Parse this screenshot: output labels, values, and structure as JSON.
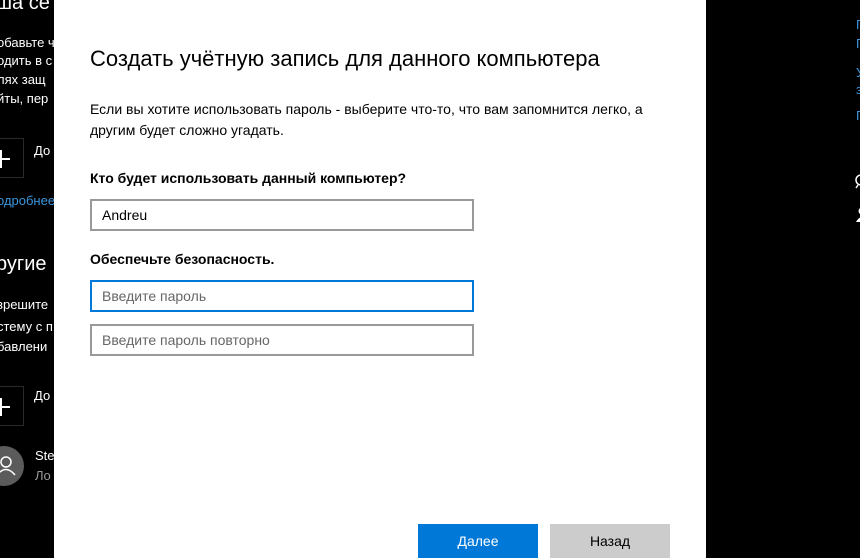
{
  "background_left": {
    "heading_top": "ша се",
    "texts": [
      "обавьте ч",
      "одить в с",
      "лях защ",
      "йты, пер"
    ],
    "add_item_1": "До",
    "link": "одробнее",
    "heading_other": "ругие",
    "texts2": [
      "зрешите",
      "стему с п",
      "бавлени"
    ],
    "add_item_2": "До",
    "user_name": "Ste",
    "user_sub": "Ло"
  },
  "background_right": {
    "links": [
      "Г",
      "П",
      "У",
      "з",
      "П"
    ]
  },
  "dialog": {
    "title": "Создать учётную запись для данного компьютера",
    "description": "Если вы хотите использовать пароль - выберите что-то, что вам запомнится легко, а другим будет сложно угадать.",
    "who_label": "Кто будет использовать данный компьютер?",
    "username_value": "Andreu",
    "security_label": "Обеспечьте безопасность.",
    "password_placeholder": "Введите пароль",
    "password_repeat_placeholder": "Введите пароль повторно",
    "next_button": "Далее",
    "back_button": "Назад"
  },
  "colors": {
    "accent": "#0078d7",
    "link": "#3a96dd",
    "secondary_button": "#cccccc"
  }
}
